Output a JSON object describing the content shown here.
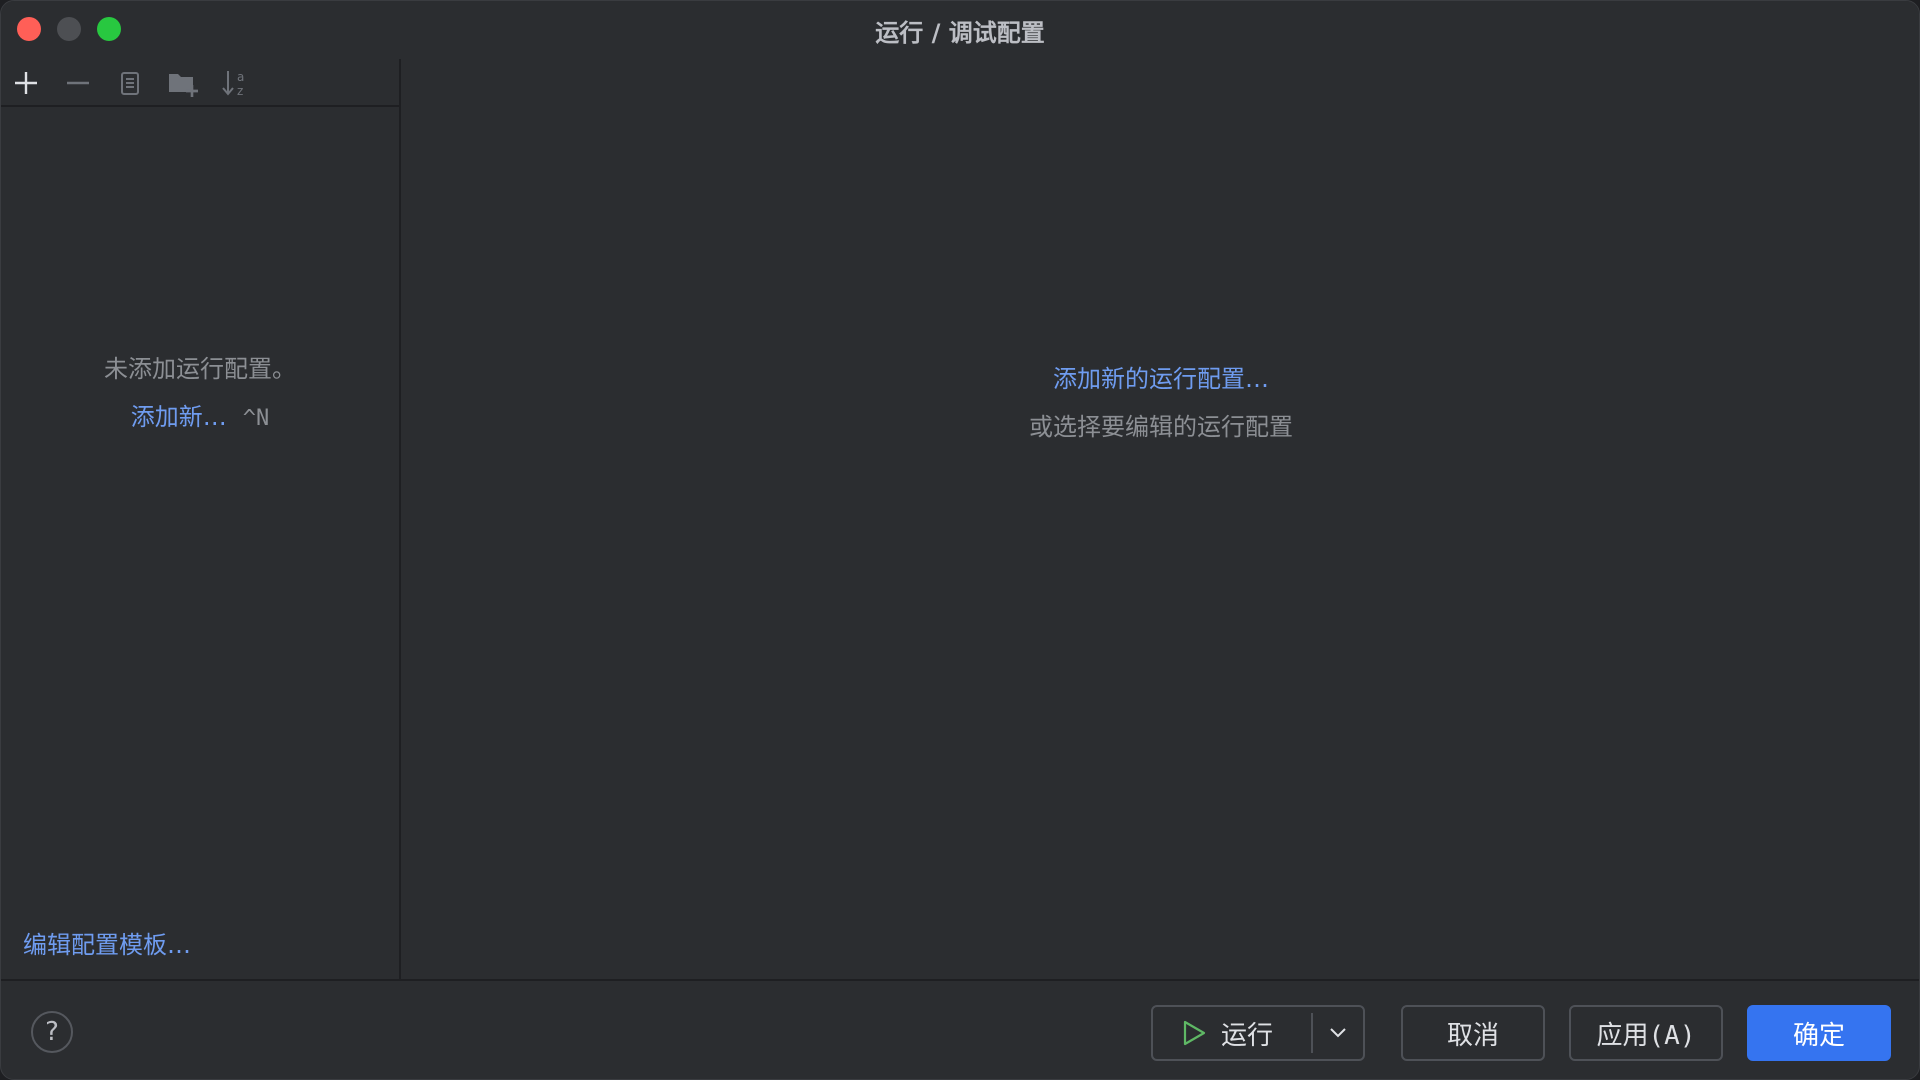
{
  "window": {
    "title": "运行 / 调试配置"
  },
  "toolbar": {
    "icons": [
      "add-icon",
      "remove-icon",
      "copy-icon",
      "new-folder-icon",
      "sort-alphabetically-icon"
    ]
  },
  "left_panel": {
    "empty_message": "未添加运行配置。",
    "add_new_label": "添加新…",
    "add_new_shortcut": "^N",
    "edit_templates_label": "编辑配置模板…"
  },
  "right_panel": {
    "add_new_config_link": "添加新的运行配置…",
    "or_select_text": "或选择要编辑的运行配置"
  },
  "footer": {
    "help_label": "?",
    "run_label": "运行",
    "cancel_label": "取消",
    "apply_label": "应用(A)",
    "ok_label": "确定"
  },
  "colors": {
    "accent": "#3574f0",
    "link": "#6f9cf0",
    "close": "#ff5f57",
    "maximize": "#28c840",
    "run_icon": "#5fb865"
  }
}
